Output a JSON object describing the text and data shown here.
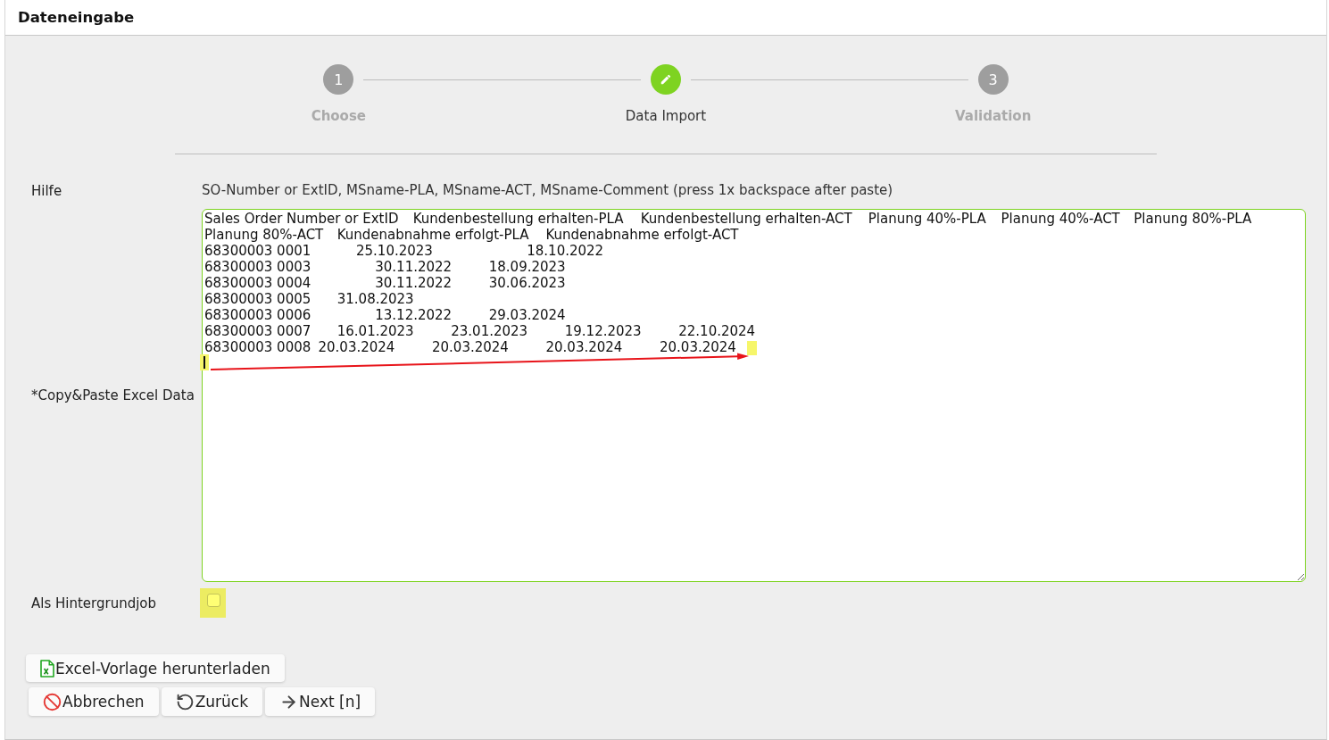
{
  "window": {
    "title": "Dateneingabe"
  },
  "steps": [
    {
      "number": "1",
      "label": "Choose",
      "selected": false
    },
    {
      "label": "Data Import",
      "selected": true
    },
    {
      "number": "3",
      "label": "Validation",
      "selected": false
    }
  ],
  "form": {
    "help": {
      "label": "Hilfe",
      "text": "SO-Number or ExtID, MSname-PLA, MSname-ACT, MSname-Comment (press 1x backspace after paste)"
    },
    "excel_data": {
      "label": "*Copy&Paste Excel Data",
      "value": "Sales Order Number or ExtID\tKundenbestellung erhalten-PLA\tKundenbestellung erhalten-ACT\tPlanung 40%-PLA\tPlanung 40%-ACT\tPlanung 80%-PLA\tPlanung 80%-ACT\tKundenabnahme erfolgt-PLA\tKundenabnahme erfolgt-ACT\n68300003 0001\t\t\t25.10.2023\t\t\t\t\t18.10.2022\n68300003 0003\t\t\t\t30.11.2022\t\t18.09.2023\n68300003 0004\t\t\t\t30.11.2022\t\t30.06.2023\n68300003 0005\t\t31.08.2023\n68300003 0006\t\t\t\t13.12.2022\t\t29.03.2024\n68300003 0007\t\t16.01.2023\t\t23.01.2023\t\t19.12.2023\t\t22.10.2024\n68300003 0008\t20.03.2024\t\t20.03.2024\t\t20.03.2024\t\t20.03.2024"
    },
    "background_job": {
      "label": "Als Hintergrundjob",
      "checked": false
    }
  },
  "template_button": {
    "label": "Excel-Vorlage herunterladen"
  },
  "buttons": [
    {
      "kind": "cancel",
      "label": "Abbrechen"
    },
    {
      "kind": "back",
      "label": "Zurück"
    },
    {
      "kind": "next",
      "label": "Next [n]"
    }
  ]
}
